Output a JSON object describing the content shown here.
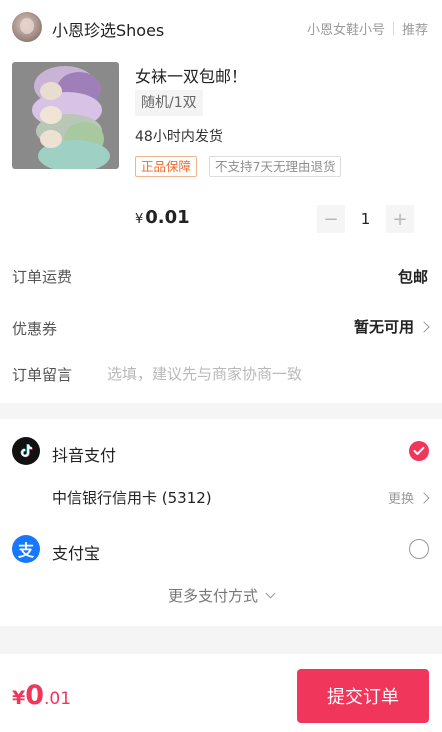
{
  "store": {
    "name": "小恩珍选Shoes",
    "links": [
      "小恩女鞋小号",
      "推荐"
    ]
  },
  "product": {
    "title": "女袜一双包邮！",
    "spec": "随机/1双",
    "ship_time": "48小时内发货",
    "tags": [
      "正品保障",
      "不支持7天无理由退货"
    ],
    "price_symbol": "¥",
    "price": "0.01",
    "quantity": "1",
    "minus": "−",
    "plus": "+"
  },
  "order": {
    "shipping_label": "订单运费",
    "shipping_value": "包邮",
    "coupon_label": "优惠券",
    "coupon_value": "暂无可用",
    "note_label": "订单留言",
    "note_placeholder": "选填，建议先与商家协商一致",
    "note_value": ""
  },
  "payment": {
    "douyin_label": "抖音支付",
    "douyin_selected": true,
    "card": "中信银行信用卡 (5312)",
    "change_label": "更换",
    "alipay_label": "支付宝",
    "alipay_icon_text": "支",
    "alipay_selected": false,
    "more_label": "更多支付方式"
  },
  "footer": {
    "total_symbol": "¥",
    "total_int": "0",
    "total_dec": ".01",
    "submit_label": "提交订单"
  },
  "colors": {
    "accent": "#f0365a",
    "guarantee": "#ee6a2c",
    "alipay": "#1677ff"
  },
  "icons": [
    "store-avatar",
    "tiktok-icon",
    "alipay-icon",
    "check-icon",
    "chevron-right-icon",
    "chevron-down-icon"
  ]
}
